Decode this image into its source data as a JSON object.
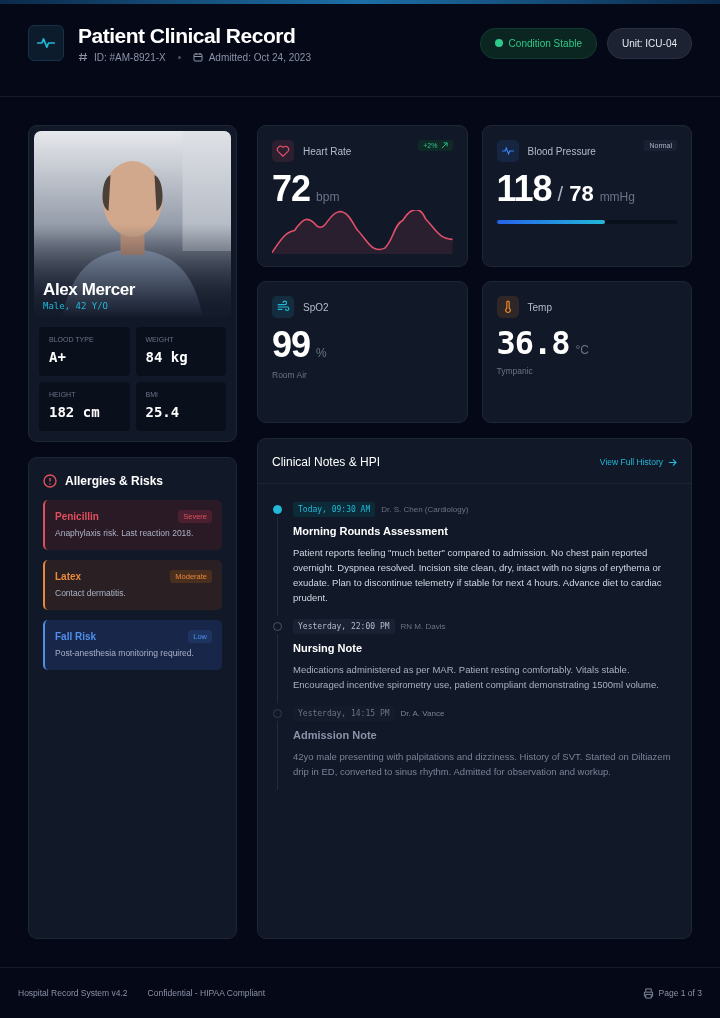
{
  "header": {
    "title": "Patient Clinical Record",
    "id": "ID: #AM-8921-X",
    "admitted": "Admitted: Oct 24, 2023",
    "status": "Condition Stable",
    "unit": "Unit: ICU-04"
  },
  "patient": {
    "kind": "picture",
    "name": "Alex Mercer",
    "subtitle": "Male, 42 Y/O",
    "stats": [
      {
        "label": "BLOOD TYPE",
        "value": "A+"
      },
      {
        "label": "WEIGHT",
        "value": "84 kg"
      },
      {
        "label": "HEIGHT",
        "value": "182 cm"
      },
      {
        "label": "BMI",
        "value": "25.4"
      }
    ]
  },
  "allergies": {
    "title": "Allergies & Risks",
    "items": [
      {
        "name": "Penicillin",
        "badge": "Severe",
        "note": "Anaphylaxis risk. Last reaction 2018.",
        "kind": "severe"
      },
      {
        "name": "Latex",
        "badge": "Moderate",
        "note": "Contact dermatitis.",
        "kind": "moderate"
      },
      {
        "name": "Fall Risk",
        "badge": "Low",
        "note": "Post-anesthesia monitoring required.",
        "kind": "low"
      }
    ]
  },
  "vitals": [
    {
      "kind": "heart",
      "label": "Heart Rate",
      "value": "72",
      "unit": "bpm",
      "badge": "+2%"
    },
    {
      "kind": "bp",
      "label": "Blood Pressure",
      "value": "118",
      "separator": "/",
      "value2": "78",
      "unit": "mmHg",
      "badge": "Normal",
      "level": 0.6
    },
    {
      "kind": "spo2",
      "label": "SpO2",
      "value": "99",
      "unit": "%",
      "sub": "Room Air"
    },
    {
      "kind": "temp",
      "label": "Temp",
      "value": "36.8",
      "unit": "°C",
      "sub": "Tympanic"
    }
  ],
  "notes": {
    "title": "Clinical Notes & HPI",
    "link": "View Full History",
    "entries": [
      {
        "kind": "active",
        "time": "Today, 09:30 AM",
        "author": "Dr. S. Chen (Cardiology)",
        "title": "Morning Rounds Assessment",
        "body": "Patient reports feeling \"much better\" compared to admission. No chest pain reported overnight. Dyspnea resolved. Incision site clean, dry, intact with no signs of erythema or exudate. Plan to discontinue telemetry if stable for next 4 hours. Advance diet to cardiac prudent."
      },
      {
        "kind": "normal",
        "time": "Yesterday, 22:00 PM",
        "author": "RN M. Davis",
        "title": "Nursing Note",
        "body": "Medications administered as per MAR. Patient resting comfortably. Vitals stable. Encouraged incentive spirometry use, patient compliant demonstrating 1500ml volume."
      },
      {
        "kind": "faded",
        "time": "Yesterday, 14:15 PM",
        "author": "Dr. A. Vance",
        "title": "Admission Note",
        "body": "42yo male presenting with palpitations and dizziness. History of SVT. Started on Diltiazem drip in ED, converted to sinus rhythm. Admitted for observation and workup."
      }
    ]
  },
  "footer": {
    "system": "Hospital Record System v4.2",
    "confidential": "Confidential - HIPAA Compliant",
    "page": "Page 1 of 3"
  }
}
